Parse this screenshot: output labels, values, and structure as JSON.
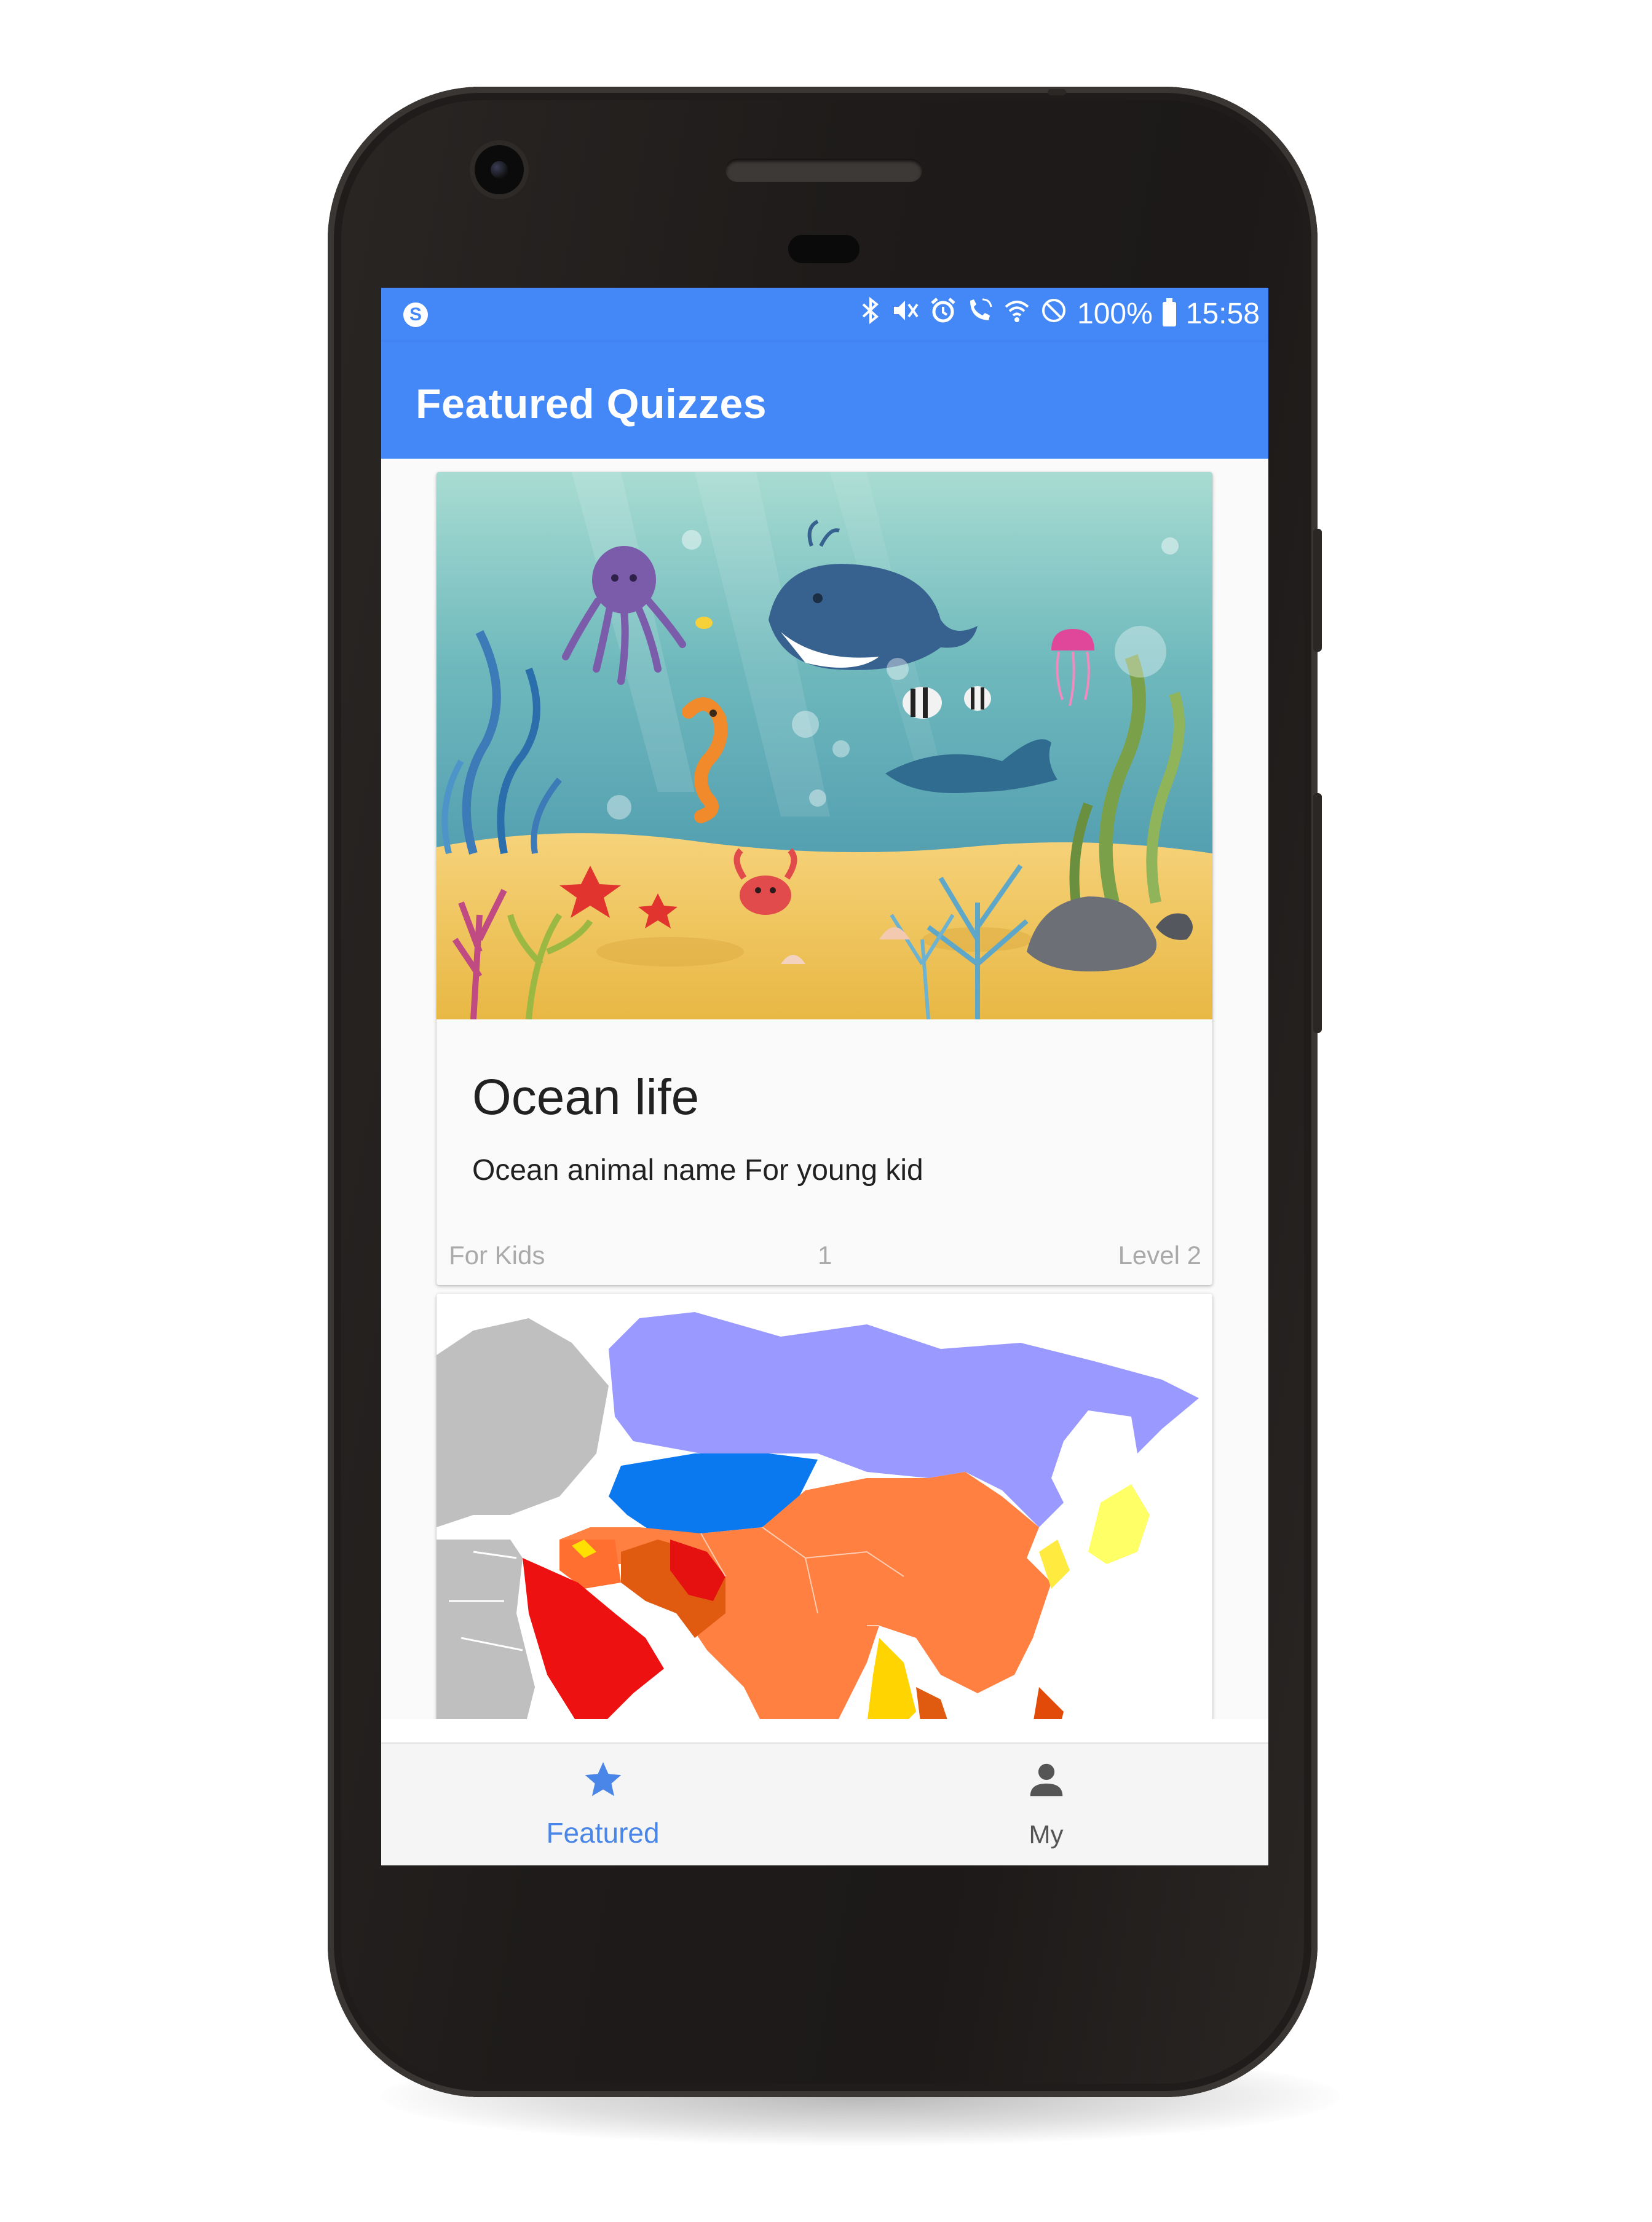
{
  "status_bar": {
    "app_icon": "S",
    "icons": [
      "bluetooth-icon",
      "mute-icon",
      "alarm-icon",
      "wifi-call-icon",
      "wifi-icon",
      "do-not-disturb-icon"
    ],
    "battery": "100%",
    "time": "15:58"
  },
  "app_bar": {
    "title": "Featured Quizzes"
  },
  "quizzes": [
    {
      "title": "Ocean life",
      "description": "Ocean animal name For young kid",
      "category": "For Kids",
      "count": "1",
      "level": "Level 2",
      "image": "ocean-illustration"
    },
    {
      "image": "asia-map"
    }
  ],
  "bottom_nav": {
    "items": [
      {
        "label": "Featured",
        "icon": "star-icon",
        "active": true
      },
      {
        "label": "My",
        "icon": "person-icon",
        "active": false
      }
    ]
  },
  "colors": {
    "primary": "#4487f7",
    "active_nav": "#4a86e8",
    "inactive_nav": "#555555"
  }
}
